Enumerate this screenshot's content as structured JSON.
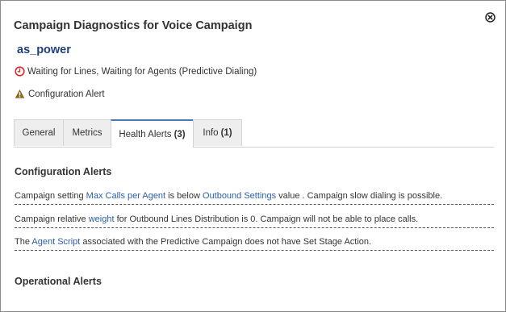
{
  "dialog": {
    "title": "Campaign Diagnostics for Voice Campaign",
    "campaign_name": "as_power",
    "status_text": "Waiting for Lines, Waiting for Agents (Predictive Dialing)",
    "alert_text": "Configuration Alert"
  },
  "tabs": [
    {
      "label": "General",
      "count": ""
    },
    {
      "label": "Metrics",
      "count": ""
    },
    {
      "label": "Health Alerts",
      "count": "(3)",
      "active": true
    },
    {
      "label": "Info",
      "count": "(1)"
    }
  ],
  "config_alerts": {
    "title": "Configuration Alerts",
    "rows": [
      {
        "t1": "Campaign setting ",
        "l1": "Max Calls per Agent",
        "t2": " is below ",
        "l2": "Outbound Settings",
        "t3": " value . Campaign slow dialing is possible."
      },
      {
        "t1": "Campaign relative ",
        "l1": "weight",
        "t2": " for Outbound Lines Distribution is 0. Campaign will not be able to place calls."
      },
      {
        "t1": "The ",
        "l1": "Agent Script",
        "t2": " associated with the Predictive Campaign does not have Set Stage Action."
      }
    ]
  },
  "operational_alerts": {
    "title": "Operational Alerts"
  },
  "colors": {
    "link": "#2a5fa8",
    "campaign_name": "#1f3f7a",
    "status_icon": "#d32f2f",
    "warning_icon": "#8a6d1f",
    "active_tab_border": "#4a78b8"
  },
  "icons": {
    "close": "close-circle-icon",
    "status": "clock-icon",
    "alert": "warning-triangle-icon"
  }
}
